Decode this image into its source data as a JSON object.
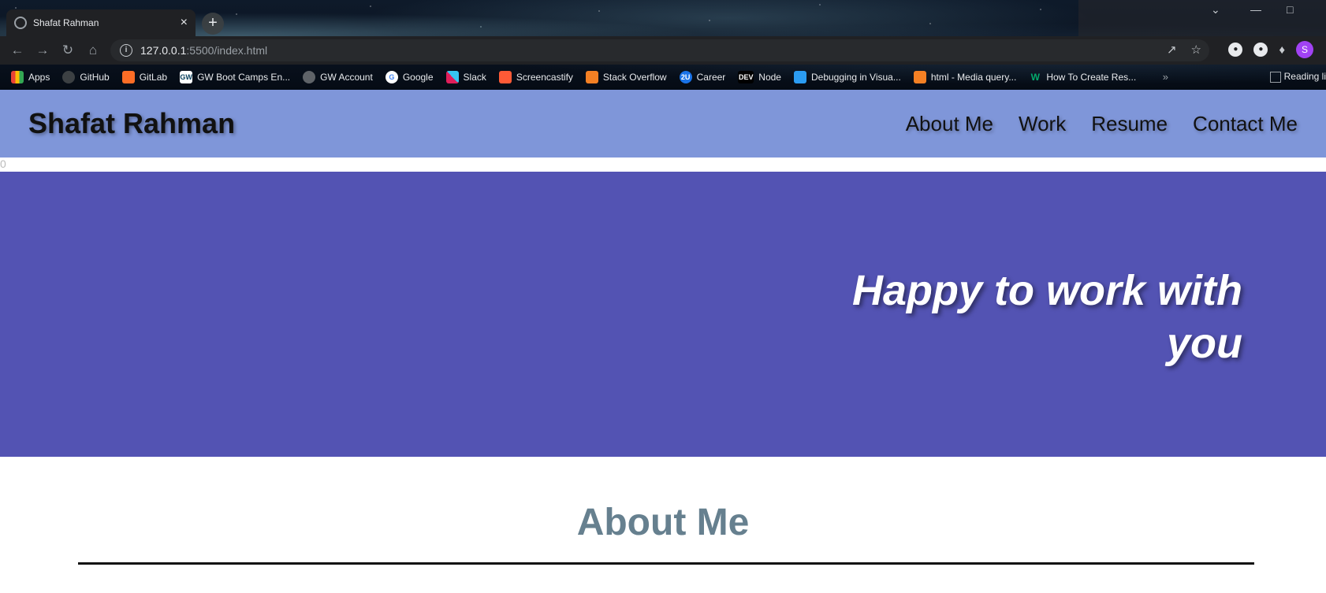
{
  "browser": {
    "tab_title": "Shafat Rahman",
    "new_tab_glyph": "+",
    "close_glyph": "×",
    "url_host": "127.0.0.1",
    "url_path": ":5500/index.html",
    "bookmarks": [
      {
        "label": "Apps",
        "icon": "apps-grid-icon",
        "color": "#ea4335"
      },
      {
        "label": "GitHub",
        "icon": "github-icon",
        "color": "#e8eaed"
      },
      {
        "label": "GitLab",
        "icon": "gitlab-icon",
        "color": "#fc6d26"
      },
      {
        "label": "GW Boot Camps En...",
        "icon": "gw-icon",
        "color": "#ffffff"
      },
      {
        "label": "GW Account",
        "icon": "globe-icon",
        "color": "#9aa0a6"
      },
      {
        "label": "Google",
        "icon": "google-icon",
        "color": "#4285f4"
      },
      {
        "label": "Slack",
        "icon": "slack-icon",
        "color": "#e01e5a"
      },
      {
        "label": "Screencastify",
        "icon": "screencastify-icon",
        "color": "#ff5a36"
      },
      {
        "label": "Stack Overflow",
        "icon": "stackoverflow-icon",
        "color": "#f48024"
      },
      {
        "label": "Career",
        "icon": "2u-icon",
        "color": "#1a73e8"
      },
      {
        "label": "Node",
        "icon": "dev-icon",
        "color": "#000000"
      },
      {
        "label": "Debugging in Visua...",
        "icon": "vscode-icon",
        "color": "#2b9cf2"
      },
      {
        "label": "html - Media query...",
        "icon": "stackoverflow-icon",
        "color": "#f48024"
      },
      {
        "label": "How To Create Res...",
        "icon": "w-icon",
        "color": "#04aa6d"
      }
    ],
    "reading_list": "Reading li",
    "profile_initial": "S"
  },
  "site": {
    "name": "Shafat Rahman",
    "nav": [
      "About Me",
      "Work",
      "Resume",
      "Contact Me"
    ],
    "stray_text": "0",
    "hero_text": "Happy to work with you",
    "about_title": "About Me"
  },
  "colors": {
    "header_bg": "#7f96d9",
    "hero_bg": "#5353b3",
    "about_title": "#66808f"
  }
}
